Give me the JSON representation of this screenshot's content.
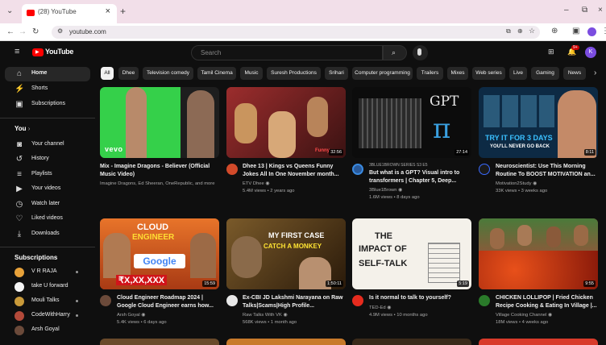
{
  "browser": {
    "tab_title": "(28) YouTube",
    "url": "youtube.com",
    "new_tab": "+",
    "close": "×"
  },
  "yt": {
    "logo": "YouTube",
    "search_placeholder": "Search",
    "avatar_letter": "K",
    "notif_count": "9+"
  },
  "sidebar": {
    "top": [
      {
        "label": "Home",
        "icon": "⌂"
      },
      {
        "label": "Shorts",
        "icon": "⚡"
      },
      {
        "label": "Subscriptions",
        "icon": "▣"
      }
    ],
    "you_header": "You",
    "you": [
      {
        "label": "Your channel",
        "icon": "◙"
      },
      {
        "label": "History",
        "icon": "↺"
      },
      {
        "label": "Playlists",
        "icon": "≡"
      },
      {
        "label": "Your videos",
        "icon": "▶"
      },
      {
        "label": "Watch later",
        "icon": "◷"
      },
      {
        "label": "Liked videos",
        "icon": "👍"
      },
      {
        "label": "Downloads",
        "icon": "⤓"
      }
    ],
    "subs_header": "Subscriptions",
    "subs": [
      {
        "label": "V R RAJA",
        "color": "#e8a23a"
      },
      {
        "label": "take U forward",
        "color": "#f4f4f4"
      },
      {
        "label": "Mouli Talks",
        "color": "#c99a3a"
      },
      {
        "label": "CodeWithHarry",
        "color": "#b34a3a"
      },
      {
        "label": "Arsh Goyal",
        "color": "#6b4a3a"
      }
    ]
  },
  "chips": [
    "All",
    "Dhee",
    "Television comedy",
    "Tamil Cinema",
    "Music",
    "Suresh Productions",
    "Srihari",
    "Computer programming",
    "Trailers",
    "Mixes",
    "Web series",
    "Live",
    "Gaming",
    "News"
  ],
  "videos": [
    {
      "title1": "Mix - Imagine Dragons - Believer (Official",
      "title2": "Music Video)",
      "meta1": "Imagine Dragons, Ed Sheeran, OneRepublic, and more",
      "meta2": "",
      "duration": "",
      "thumb_text": "vevo"
    },
    {
      "title1": "Dhee 13 | Kings vs Queens Funny",
      "title2": "Jokes All In One November month...",
      "meta1": "ETV Dhee ◉",
      "meta2": "5.4M views • 2 years ago",
      "duration": "32:56",
      "thumb_text": "Funny"
    },
    {
      "title1": "But what is a GPT? Visual intro to",
      "title2": "transformers | Chapter 5, Deep...",
      "meta1": "3Blue1Brown ◉",
      "meta2": "1.6M views • 8 days ago",
      "duration": "27:14",
      "thumb_text": "GPT",
      "kicker": "3BLUE1BROWN SERIES S3 E5"
    },
    {
      "title1": "Neuroscientist: Use This Morning",
      "title2": "Routine To BOOST MOTIVATION an...",
      "meta1": "Motivation2Study ◉",
      "meta2": "33K views • 3 weeks ago",
      "duration": "8:11",
      "thumb_text": "TRY IT FOR 3 DAYS",
      "thumb_text2": "YOU'LL NEVER GO BACK"
    },
    {
      "title1": "Cloud Engineer Roadmap 2024 |",
      "title2": "Google Cloud Engineer earns how...",
      "meta1": "Arsh Goyal ◉",
      "meta2": "5.4K views • 6 days ago",
      "duration": "15:59",
      "thumb_text": "CLOUD",
      "thumb_text2": "ENGINEER",
      "thumb_text3": "Google",
      "thumb_text4": "₹X,XX,XXX"
    },
    {
      "title1": "Ex-CBI JD Lakshmi Narayana on Raw",
      "title2": "Talks|Scams|High Profile...",
      "meta1": "Raw Talks With VK ◉",
      "meta2": "568K views • 1 month ago",
      "duration": "1:50:11",
      "thumb_text": "MY FIRST CASE",
      "thumb_text2": "CATCH A MONKEY"
    },
    {
      "title1": "Is it normal to talk to yourself?",
      "title2": "",
      "meta1": "TED-Ed ◉",
      "meta2": "4.9M views • 10 months ago",
      "duration": "5:19",
      "thumb_text": "THE",
      "thumb_text2": "IMPACT OF",
      "thumb_text3": "SELF-TALK"
    },
    {
      "title1": "CHICKEN LOLLIPOP | Fried Chicken",
      "title2": "Recipe Cooking & Eating In Village |...",
      "meta1": "Village Cooking Channel ◉",
      "meta2": "18M views • 4 weeks ago",
      "duration": "9:55",
      "thumb_text": ""
    }
  ]
}
